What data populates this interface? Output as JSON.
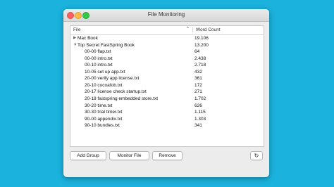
{
  "window": {
    "title": "File Monitoring"
  },
  "table": {
    "columns": {
      "file": "File",
      "word_count": "Word Count"
    },
    "rows": [
      {
        "name": "Mac Book",
        "count": "19.106",
        "level": 0,
        "disclosure": "▶"
      },
      {
        "name": "Top Secret FastSpring Book",
        "count": "13.200",
        "level": 0,
        "disclosure": "▼"
      },
      {
        "name": "00-00 flap.txt",
        "count": "64",
        "level": 1
      },
      {
        "name": "00-00 intro.txt",
        "count": "2.438",
        "level": 1
      },
      {
        "name": "00-10 intro.txt",
        "count": "2.718",
        "level": 1
      },
      {
        "name": "10-05 set up app.txt",
        "count": "432",
        "level": 1
      },
      {
        "name": "20-00 verify app license.txt",
        "count": "361",
        "level": 1
      },
      {
        "name": "20-10 cocoafob.txt",
        "count": "172",
        "level": 1
      },
      {
        "name": "20-17 license check startup.txt",
        "count": "271",
        "level": 1
      },
      {
        "name": "20-18 fastspring embedded store.txt",
        "count": "1.702",
        "level": 1
      },
      {
        "name": "30-20 time.txt",
        "count": "626",
        "level": 1
      },
      {
        "name": "30-30 trial timer.txt",
        "count": "1.115",
        "level": 1
      },
      {
        "name": "90-00 appendix.txt",
        "count": "1.303",
        "level": 1
      },
      {
        "name": "90-10 bundles.txt",
        "count": "341",
        "level": 1
      }
    ]
  },
  "buttons": {
    "add_group": "Add Group",
    "monitor_file": "Monitor File",
    "remove": "Remove",
    "refresh": "↻"
  },
  "icons": {
    "sort": "chevron-up-icon",
    "refresh": "refresh-icon",
    "expand": "disclosure-triangle-icon"
  },
  "colors": {
    "background": "#1bb2dd",
    "close": "#fc605c",
    "minimize": "#fdbc40",
    "maximize": "#34c84a"
  }
}
